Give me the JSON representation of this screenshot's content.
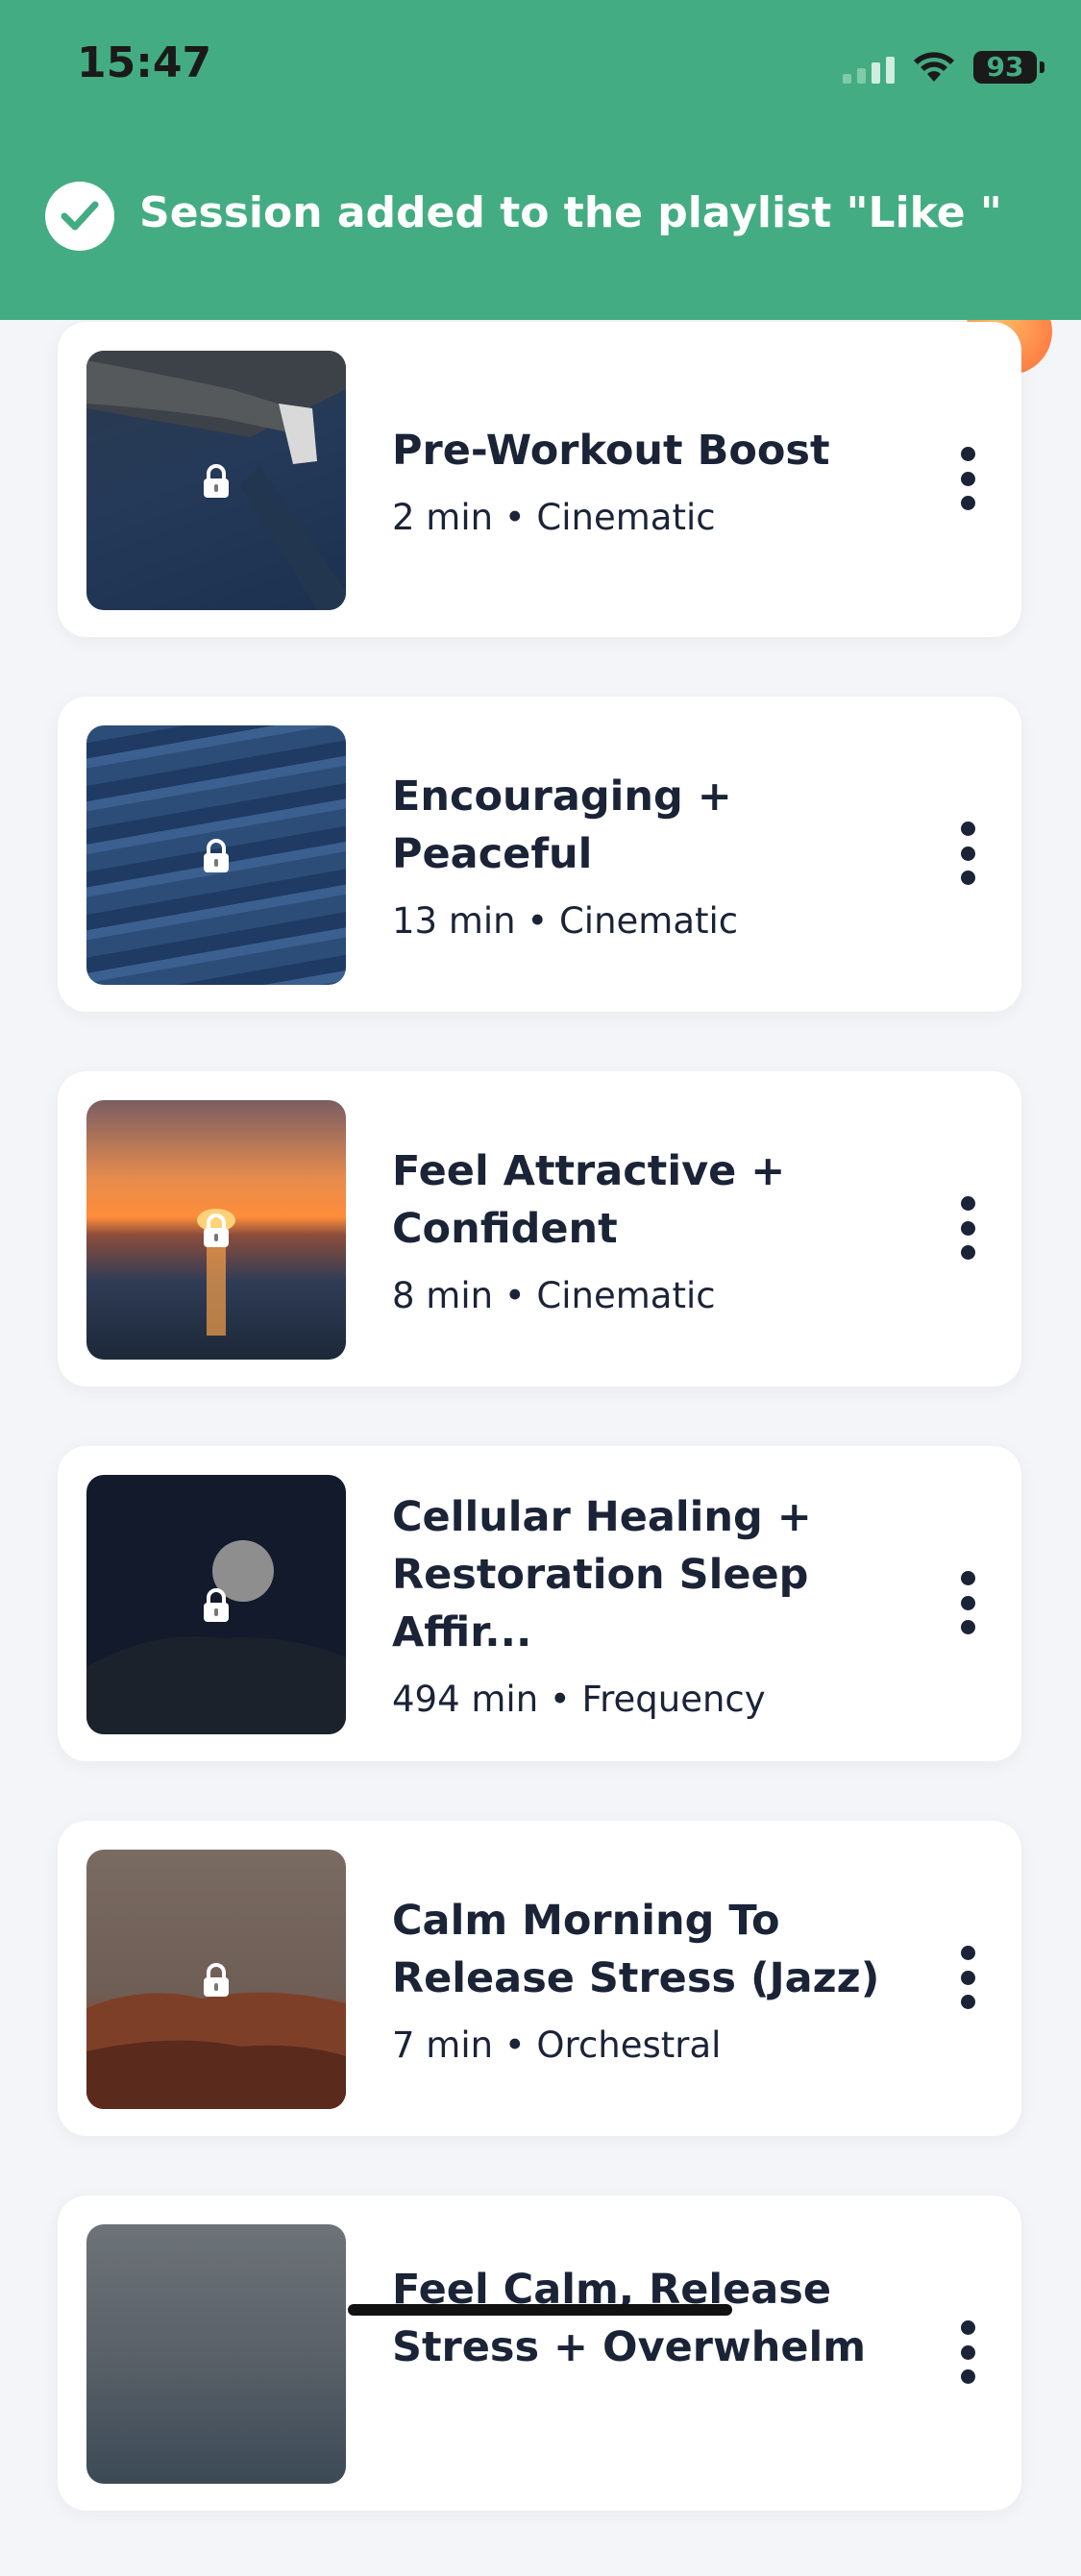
{
  "status_bar": {
    "time": "15:47",
    "battery": "93"
  },
  "toast": {
    "message": "Session added to the playlist \"Like \""
  },
  "sessions": [
    {
      "title": "Pre-Workout Boost",
      "meta": "2 min • Cinematic"
    },
    {
      "title": "Encouraging + Peaceful",
      "meta": "13 min • Cinematic"
    },
    {
      "title": "Feel Attractive + Confident",
      "meta": "8 min • Cinematic"
    },
    {
      "title": "Cellular Healing + Restoration Sleep Affir...",
      "meta": "494 min • Frequency"
    },
    {
      "title": "Calm Morning To Release Stress (Jazz)",
      "meta": "7 min • Orchestral"
    },
    {
      "title": "Feel Calm, Release Stress + Overwhelm",
      "meta": ""
    }
  ],
  "colors": {
    "toast_bg": "#44ac82",
    "text": "#1b2337",
    "page_bg": "#f4f5f8"
  }
}
